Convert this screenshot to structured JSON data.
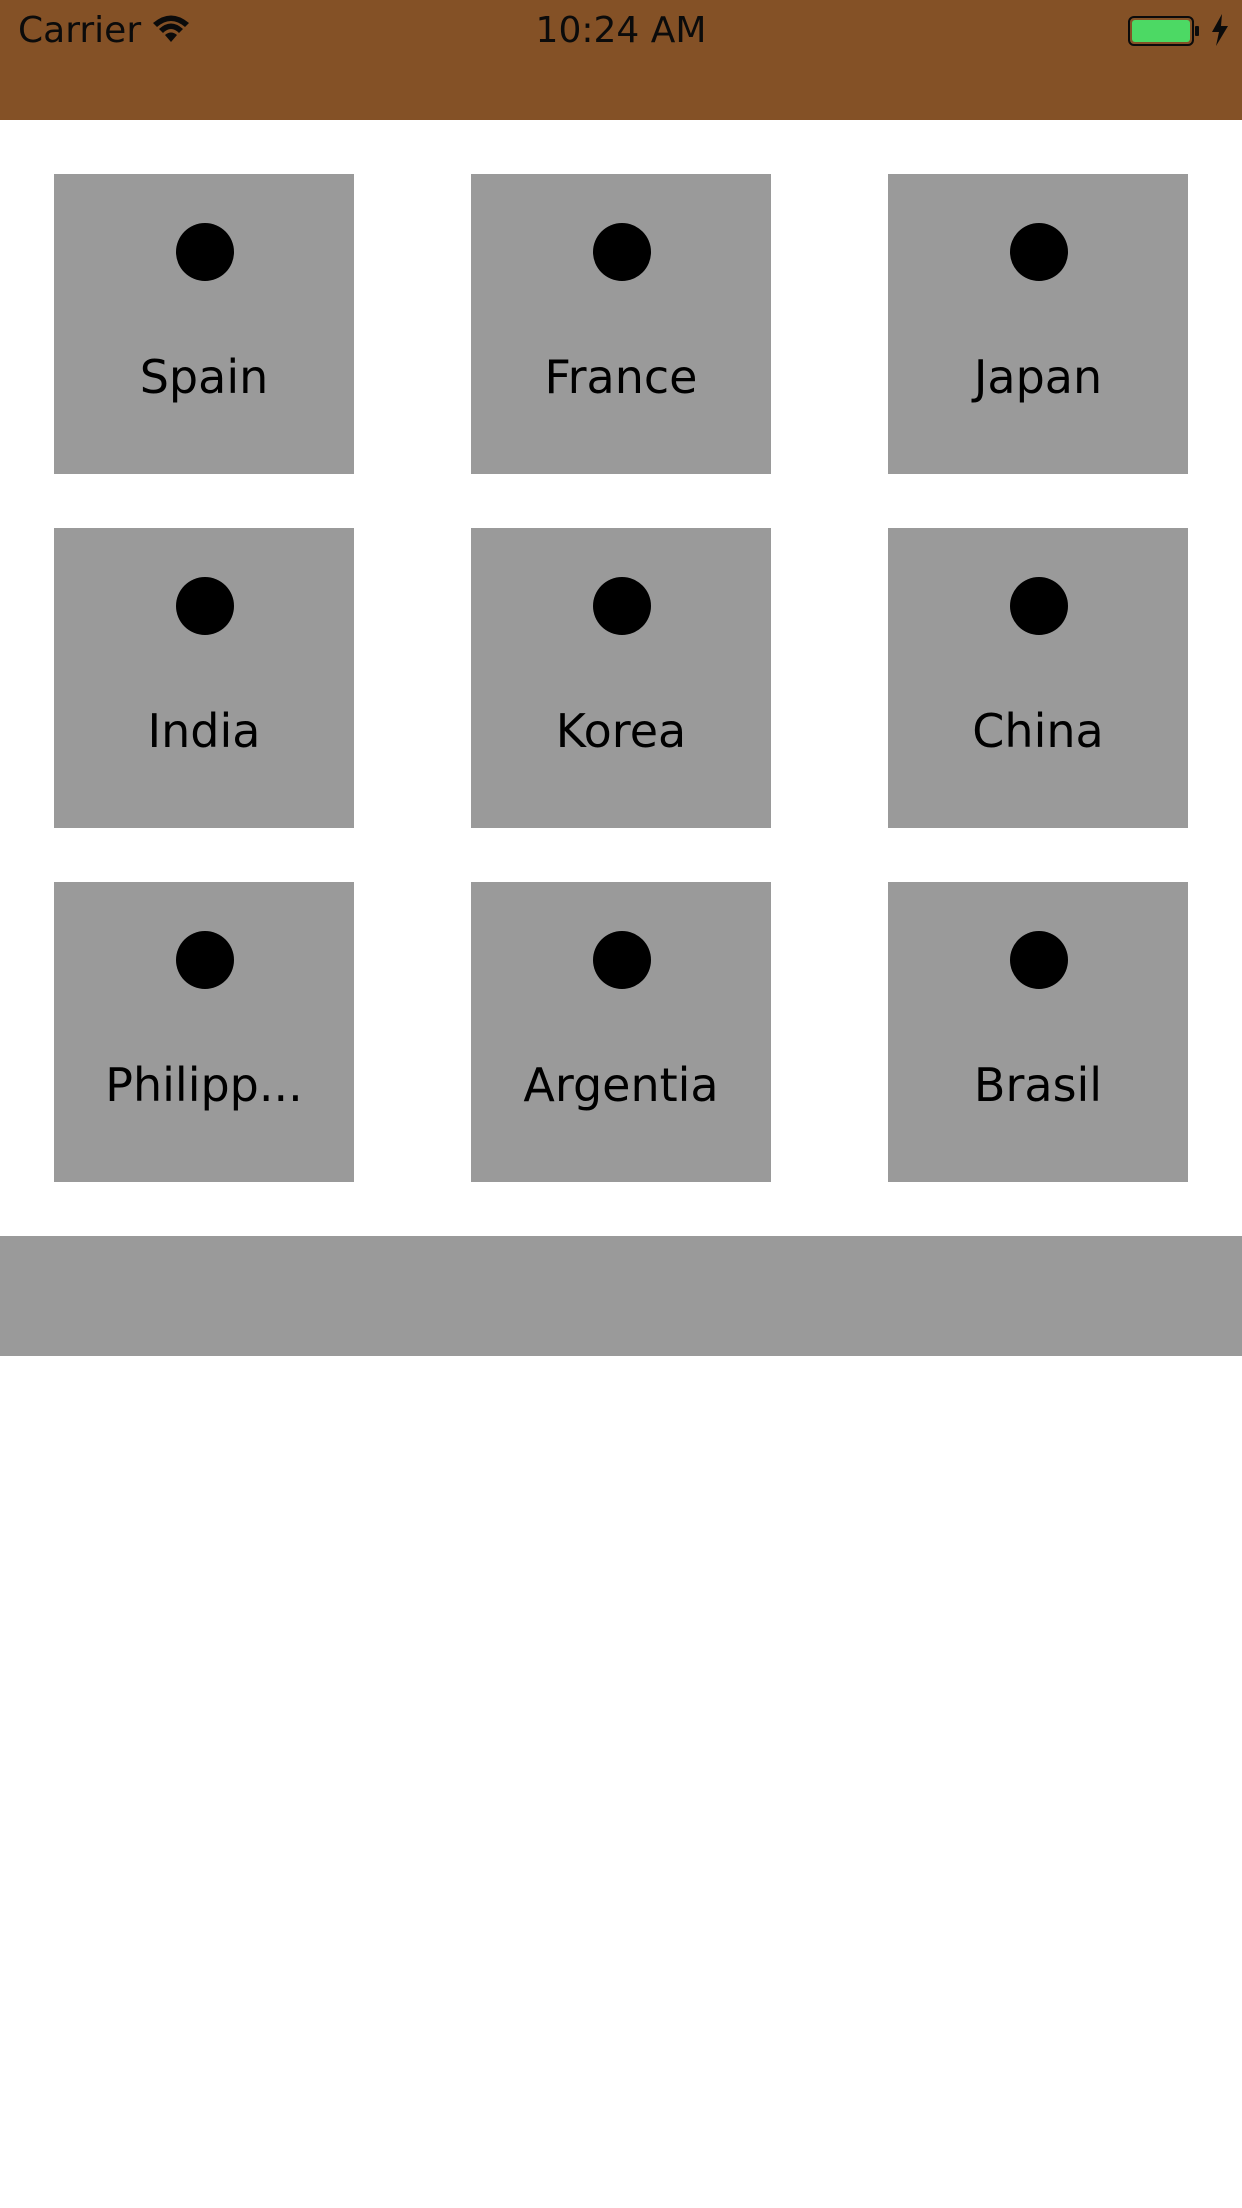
{
  "status_bar": {
    "carrier": "Carrier",
    "time": "10:24 AM",
    "wifi_icon": "wifi-icon",
    "battery_icon": "battery-icon",
    "charging_icon": "charging-bolt-icon",
    "background_color": "#845126",
    "battery_color": "#4cd964"
  },
  "countries": [
    {
      "label": "Spain",
      "icon": "dot-icon"
    },
    {
      "label": "France",
      "icon": "dot-icon"
    },
    {
      "label": "Japan",
      "icon": "dot-icon"
    },
    {
      "label": "India",
      "icon": "dot-icon"
    },
    {
      "label": "Korea",
      "icon": "dot-icon"
    },
    {
      "label": "China",
      "icon": "dot-icon"
    },
    {
      "label": "Philipp...",
      "icon": "dot-icon"
    },
    {
      "label": "Argentia",
      "icon": "dot-icon"
    },
    {
      "label": "Brasil",
      "icon": "dot-icon"
    }
  ],
  "colors": {
    "tile": "#9a9a9a",
    "bottom_bar": "#9a9a9a",
    "dot": "#000000"
  }
}
